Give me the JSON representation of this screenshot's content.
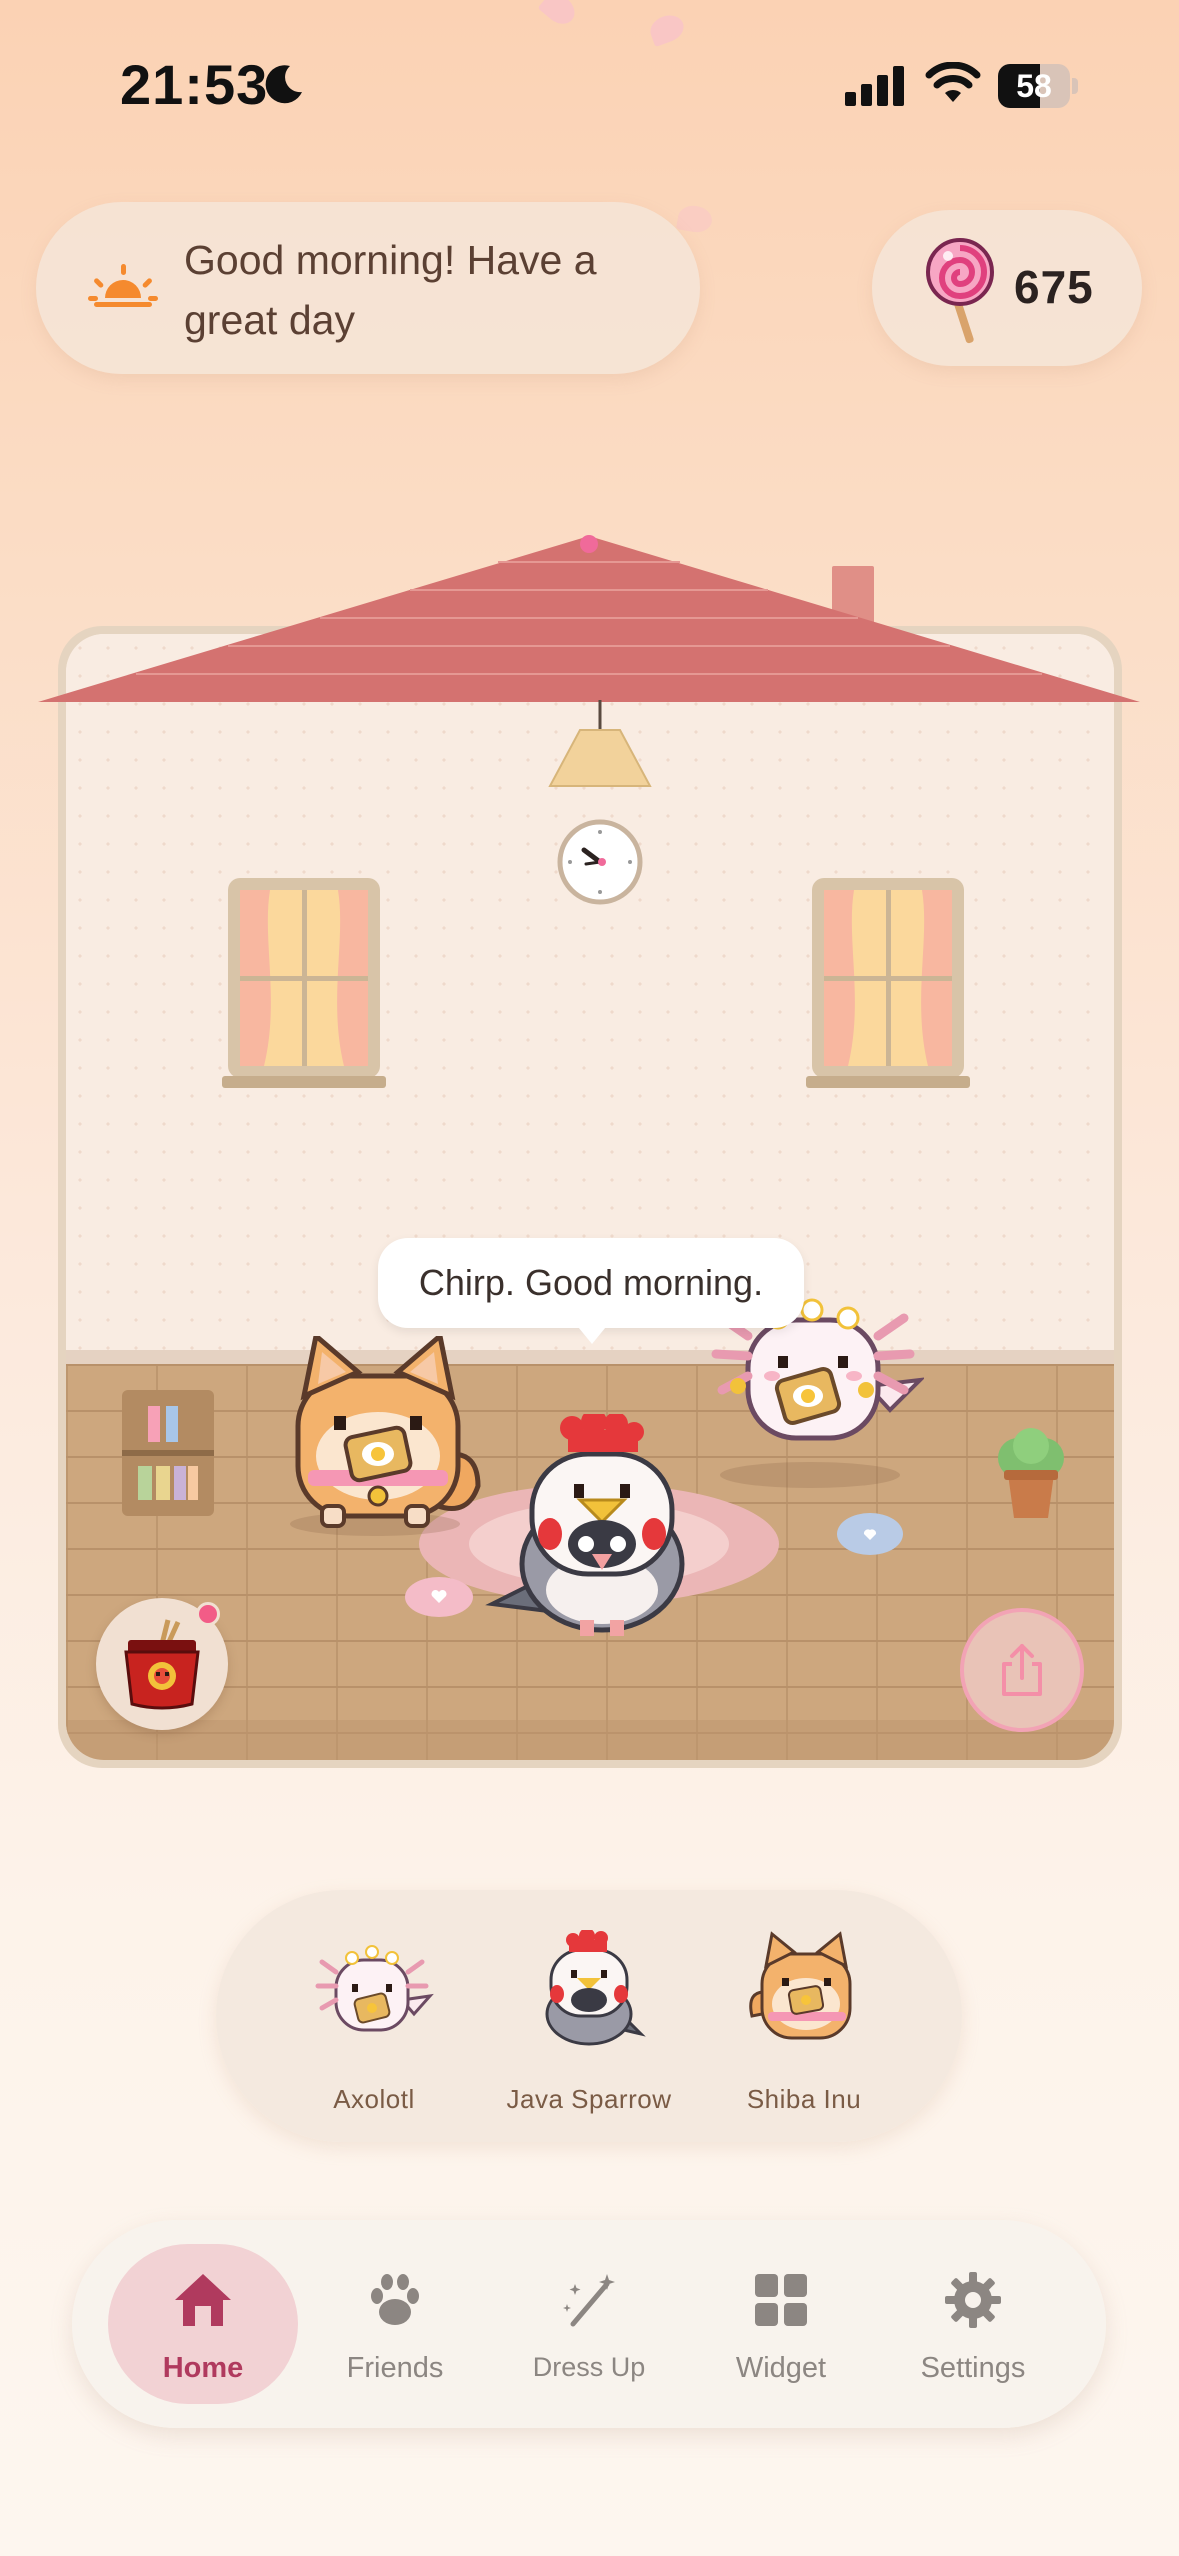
{
  "status_bar": {
    "time": "21:53",
    "battery": "58",
    "battery_fraction": 0.58,
    "icons": [
      "moon-icon",
      "signal-icon",
      "wifi-icon",
      "battery-icon"
    ]
  },
  "header": {
    "greeting": "Good morning! Have a great day",
    "greeting_icon": "sunrise-icon",
    "candy_icon": "lollipop-icon",
    "candy_count": "675"
  },
  "room": {
    "speech_bubble": "Chirp. Good morning.",
    "pets": [
      "shiba-inu",
      "java-sparrow",
      "axolotl"
    ],
    "actions": {
      "food_icon": "ramen-icon",
      "share_icon": "share-icon"
    }
  },
  "pet_selector": {
    "pets": [
      {
        "name": "Axolotl",
        "icon": "axolotl-icon"
      },
      {
        "name": "Java Sparrow",
        "icon": "java-sparrow-icon"
      },
      {
        "name": "Shiba Inu",
        "icon": "shiba-inu-icon"
      }
    ]
  },
  "tab_bar": {
    "tabs": [
      {
        "label": "Home",
        "icon": "home-icon",
        "active": true
      },
      {
        "label": "Friends",
        "icon": "paw-icon",
        "active": false
      },
      {
        "label": "Dress Up",
        "icon": "magic-wand-icon",
        "active": false
      },
      {
        "label": "Widget",
        "icon": "widget-grid-icon",
        "active": false
      },
      {
        "label": "Settings",
        "icon": "gear-icon",
        "active": false
      }
    ]
  },
  "colors": {
    "accent": "#b03a5e",
    "roof": "#d06a6a",
    "notification": "#f25c87"
  }
}
